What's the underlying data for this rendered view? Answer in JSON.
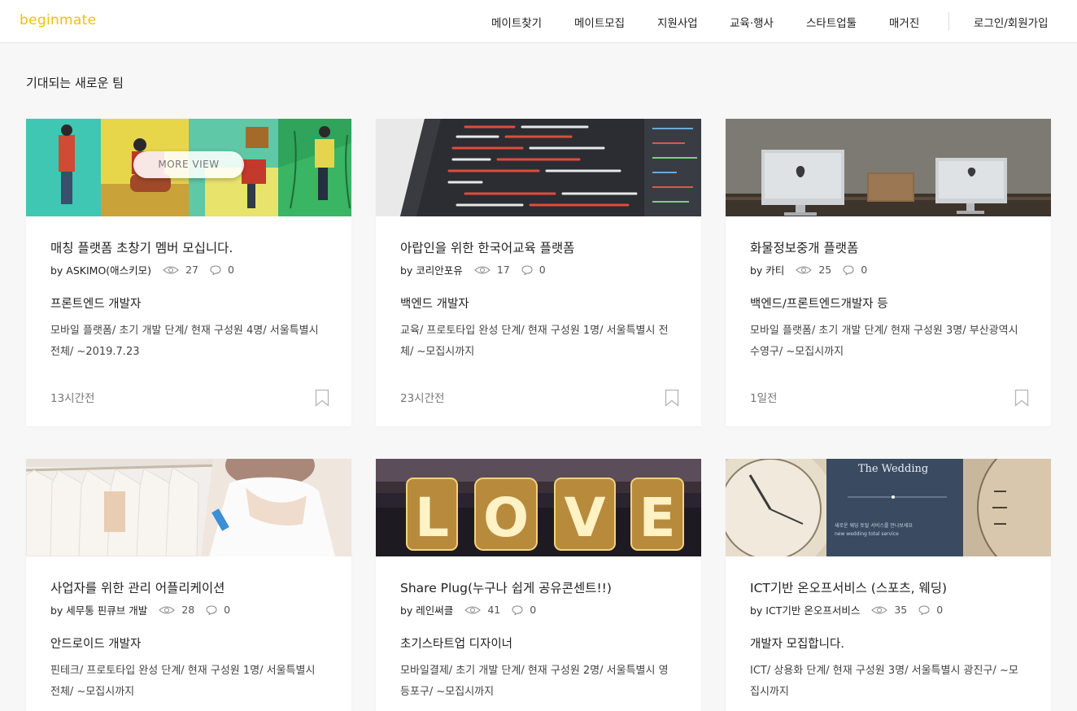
{
  "header": {
    "logo": "beginmate",
    "nav": [
      "메이트찾기",
      "메이트모집",
      "지원사업",
      "교육·행사",
      "스타트업툴",
      "매거진"
    ],
    "login": "로그인/회원가입"
  },
  "section": {
    "title": "기대되는 새로운 팀"
  },
  "more_view": "MORE VIEW",
  "cards": [
    {
      "title": "매칭 플랫폼 초창기 멤버 모십니다.",
      "by": "by ASKIMO(애스키모)",
      "views": "27",
      "comments": "0",
      "role": "프론트엔드 개발자",
      "desc": "모바일 플랫폼/ 초기 개발 단계/ 현재 구성원 4명/ 서울특별시 전체/ ~2019.7.23",
      "time": "13시간전"
    },
    {
      "title": "아랍인을 위한 한국어교육 플랫폼",
      "by": "by 코리안포유",
      "views": "17",
      "comments": "0",
      "role": "백엔드 개발자",
      "desc": "교육/ 프로토타입 완성 단계/ 현재 구성원 1명/ 서울특별시 전체/ ~모집시까지",
      "time": "23시간전"
    },
    {
      "title": "화물정보중개 플랫폼",
      "by": "by 카티",
      "views": "25",
      "comments": "0",
      "role": "백엔드/프론트엔드개발자 등",
      "desc": "모바일 플랫폼/ 초기 개발 단계/ 현재 구성원 3명/ 부산광역시 수영구/ ~모집시까지",
      "time": "1일전"
    },
    {
      "title": "사업자를 위한 관리 어플리케이션",
      "by": "by 세무통 핀큐브 개발",
      "views": "28",
      "comments": "0",
      "role": "안드로이드 개발자",
      "desc": "핀테크/ 프로토타입 완성 단계/ 현재 구성원 1명/ 서울특별시 전체/ ~모집시까지",
      "time": ""
    },
    {
      "title": "Share Plug(누구나 쉽게 공유콘센트!!)",
      "by": "by 레인써클",
      "views": "41",
      "comments": "0",
      "role": "초기스타트업 디자이너",
      "desc": "모바일결제/ 초기 개발 단계/ 현재 구성원 2명/ 서울특별시 영등포구/ ~모집시까지",
      "time": ""
    },
    {
      "title": "ICT기반 온오프서비스 (스포츠, 웨딩)",
      "by": "by ICT기반 온오프서비스",
      "views": "35",
      "comments": "0",
      "role": "개발자 모집합니다.",
      "desc": "ICT/ 상용화 단계/ 현재 구성원 3명/ 서울특별시 광진구/ ~모집시까지",
      "time": ""
    }
  ],
  "thumb_text": {
    "love": [
      "L",
      "O",
      "V",
      "E"
    ],
    "wedding_title": "The Wedding",
    "wedding_line1": "새로운 웨딩 토탈 서비스를 만나보세요",
    "wedding_line2": "new wedding total service"
  },
  "colors": {
    "brand": "#f2c200"
  }
}
